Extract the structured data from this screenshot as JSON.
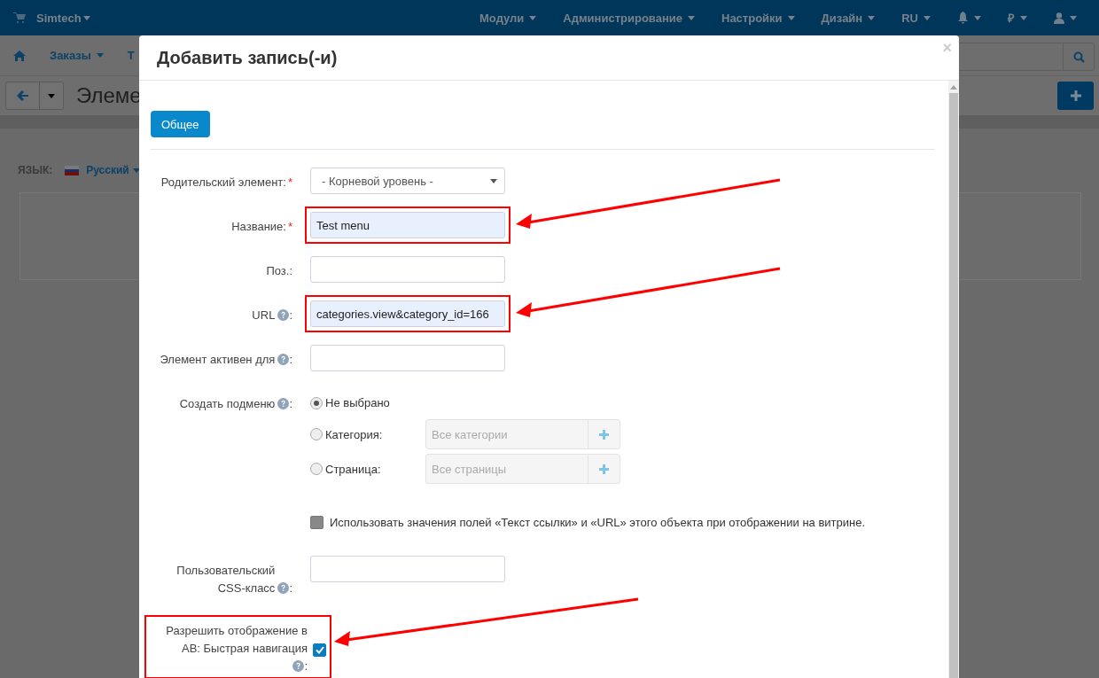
{
  "top_nav": {
    "brand": "Simtech",
    "menus": [
      {
        "label": "Модули"
      },
      {
        "label": "Администрирование"
      },
      {
        "label": "Настройки"
      },
      {
        "label": "Дизайн"
      },
      {
        "label": "RU"
      }
    ],
    "currency": "₽"
  },
  "sub_nav": {
    "items": [
      "Заказы",
      "Т"
    ]
  },
  "page_title": "Элеме",
  "language": {
    "label": "ЯЗЫК:",
    "value": "Русский"
  },
  "modal": {
    "title": "Добавить запись(-и)",
    "close": "×",
    "tabs": [
      {
        "label": "Общее",
        "selected": true
      }
    ],
    "fields": [
      {
        "kind": "select",
        "label": "Родительский элемент:",
        "required_mark": "*",
        "value": "- Корневой уровень -"
      },
      {
        "kind": "text",
        "label": "Название:",
        "required_mark": "*",
        "value": "Test menu",
        "autofilled": true,
        "highlighted": true
      },
      {
        "kind": "text",
        "label": "Поз.:"
      },
      {
        "kind": "text",
        "label": "URL",
        "help": true,
        "suffix": ":",
        "value": "categories.view&category_id=166",
        "autofilled": true,
        "highlighted": true
      },
      {
        "kind": "text",
        "label": "Элемент активен для",
        "help": true,
        "suffix": ":"
      },
      {
        "kind": "radio_group",
        "label": "Создать подменю",
        "help": true,
        "suffix": ":",
        "options": [
          {
            "label": "Не выбрано",
            "selected": true
          },
          {
            "label": "Категория:",
            "selected": false,
            "placeholder": "Все категории"
          },
          {
            "label": "Страница:",
            "selected": false,
            "placeholder": "Все страницы"
          }
        ]
      },
      {
        "kind": "checkbox",
        "text": "Использовать значения полей «Текст ссылки» и «URL» этого объекта при отображении на витрине.",
        "checked": false,
        "disabled": true
      },
      {
        "kind": "text",
        "label": "Пользовательский CSS-класс",
        "help": true,
        "suffix": ":"
      },
      {
        "kind": "check_field",
        "label": "Разрешить отображение в АВ: Быстрая навигация",
        "help": true,
        "suffix": ":",
        "checked": true,
        "highlighted": true
      }
    ]
  }
}
